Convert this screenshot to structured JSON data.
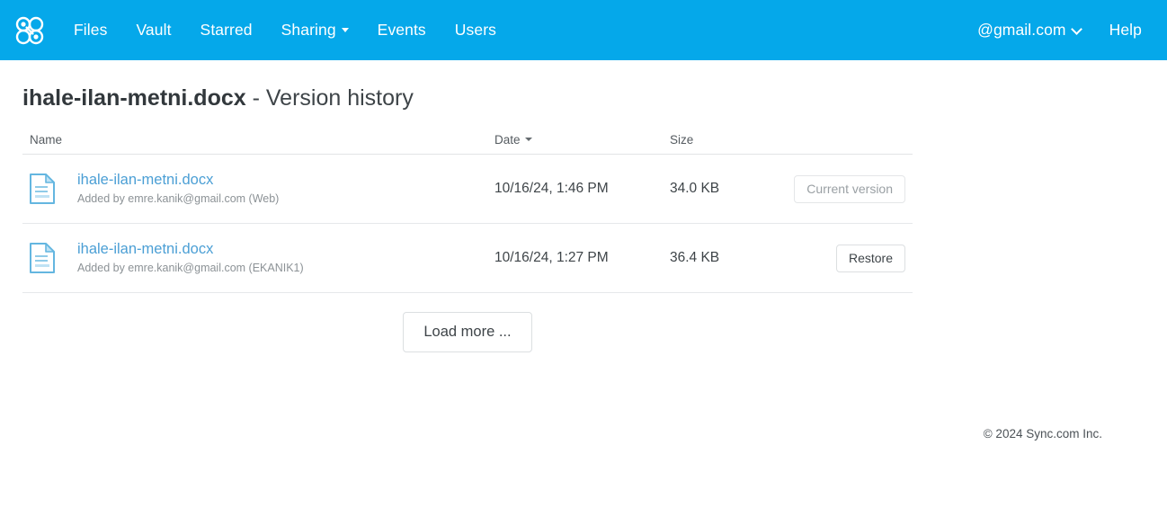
{
  "brand": {
    "accent_color": "#05a8ea",
    "logo_icon": "sync-clover-logo-icon"
  },
  "navbar": {
    "items": [
      {
        "label": "Files",
        "icon": null,
        "has_dropdown": false
      },
      {
        "label": "Vault",
        "icon": null,
        "has_dropdown": false
      },
      {
        "label": "Starred",
        "icon": null,
        "has_dropdown": false
      },
      {
        "label": "Sharing",
        "icon": "caret-down-icon",
        "has_dropdown": true
      },
      {
        "label": "Events",
        "icon": null,
        "has_dropdown": false
      },
      {
        "label": "Users",
        "icon": null,
        "has_dropdown": false
      }
    ],
    "account": {
      "label": "@gmail.com",
      "icon": "chevron-down-icon"
    },
    "help": {
      "label": "Help"
    }
  },
  "page": {
    "file_name": "ihale-ilan-metni.docx",
    "title_suffix": " - Version history"
  },
  "table": {
    "columns": {
      "name": "Name",
      "date": "Date",
      "date_sort_icon": "sort-caret-down-icon",
      "size": "Size"
    },
    "rows": [
      {
        "file_icon": "document-file-icon",
        "name": "ihale-ilan-metni.docx",
        "added_by": "Added by emre.kanik@gmail.com (Web)",
        "date": "10/16/24, 1:46 PM",
        "size": "34.0 KB",
        "action_label": "Current version",
        "action_enabled": false
      },
      {
        "file_icon": "document-file-icon",
        "name": "ihale-ilan-metni.docx",
        "added_by": "Added by emre.kanik@gmail.com (EKANIK1)",
        "date": "10/16/24, 1:27 PM",
        "size": "36.4 KB",
        "action_label": "Restore",
        "action_enabled": true
      }
    ]
  },
  "load_more": {
    "label": "Load more ..."
  },
  "footer": {
    "copyright": "© 2024 Sync.com Inc."
  }
}
